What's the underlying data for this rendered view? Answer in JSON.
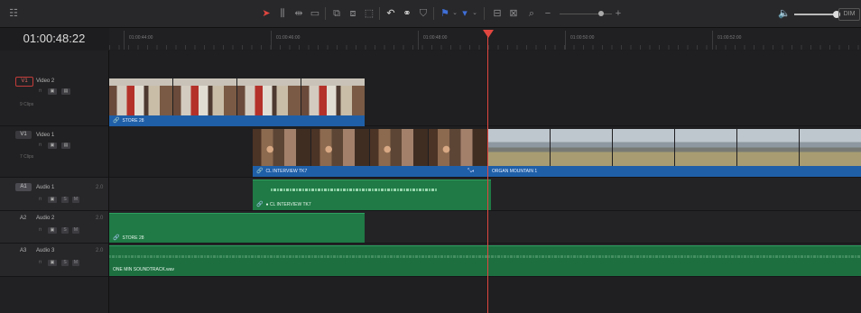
{
  "viewer": {
    "timecode": "01:00:48:22"
  },
  "ruler": {
    "labels": [
      "01:00:44:00",
      "01:00:46:00",
      "01:00:48:00",
      "01:00:50:00",
      "01:00:52:00"
    ]
  },
  "toolbar": {
    "dim_label": "DIM"
  },
  "tracks": [
    {
      "id": "V1",
      "name": "Video 2",
      "clips": "9 Clips",
      "selected": true
    },
    {
      "id": "V1",
      "name": "Video 1",
      "clips": "7 Clips",
      "selected": false
    },
    {
      "id": "A1",
      "name": "Audio 1",
      "channels": "2.0"
    },
    {
      "id": "A2",
      "name": "Audio 2",
      "channels": "2.0"
    },
    {
      "id": "A3",
      "name": "Audio 3",
      "channels": "2.0"
    }
  ],
  "track_buttons": {
    "solo": "S",
    "mute": "M"
  },
  "clips": {
    "video2_store": "STORE 28",
    "video1_interview": "CL INTERVIEW TK7",
    "video1_mountain": "ORGAN MOUNTAIN 1",
    "audio1_interview": "CL INTERVIEW TK7",
    "audio2_store": "STORE 28",
    "audio3_soundtrack": "ONE MIN SOUNDTRACK.wav"
  },
  "colors": {
    "video_clip_bar": "#1f5fa8",
    "audio_clip": "#1f7a45",
    "playhead": "#e0463f"
  }
}
